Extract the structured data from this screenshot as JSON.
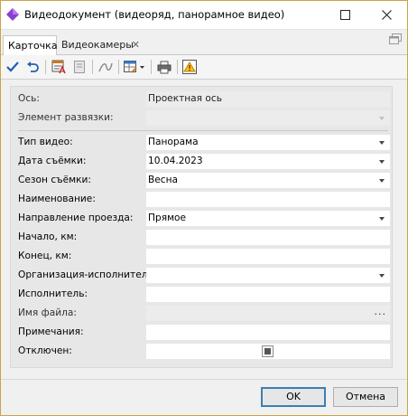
{
  "window": {
    "title": "Видеодокумент (видеоряд, панорамное видео)"
  },
  "tabs": [
    {
      "label": "Карточка",
      "active": true
    },
    {
      "label": "Видеокамеры",
      "active": false,
      "closable": true
    }
  ],
  "toolbar": {
    "items": [
      "check-icon",
      "undo-icon",
      "card-edit-icon",
      "document-icon",
      "curve-icon",
      "table-settings-icon",
      "printer-icon",
      "warning-icon"
    ]
  },
  "form": {
    "axis": {
      "label": "Ось:",
      "value": "Проектная ось"
    },
    "binding_element": {
      "label": "Элемент развязки:",
      "value": ""
    },
    "video_type": {
      "label": "Тип видео:",
      "value": "Панорама"
    },
    "shoot_date": {
      "label": "Дата съёмки:",
      "value": "10.04.2023"
    },
    "shoot_season": {
      "label": "Сезон съёмки:",
      "value": "Весна"
    },
    "name": {
      "label": "Наименование:",
      "value": ""
    },
    "direction": {
      "label": "Направление проезда:",
      "value": "Прямое"
    },
    "start_km": {
      "label": "Начало, км:",
      "value": ""
    },
    "end_km": {
      "label": "Конец, км:",
      "value": ""
    },
    "org": {
      "label": "Организация-исполнитель:",
      "value": ""
    },
    "executor": {
      "label": "Исполнитель:",
      "value": ""
    },
    "file_name": {
      "label": "Имя файла:",
      "value": "",
      "button": "..."
    },
    "notes": {
      "label": "Примечания:",
      "value": ""
    },
    "disabled": {
      "label": "Отключен:",
      "checked": "indeterminate"
    }
  },
  "buttons": {
    "ok": "OK",
    "cancel": "Отмена"
  },
  "colors": {
    "accent_border": "#3c7fb1",
    "window_border": "#c9a54a",
    "app_icon": "#8a3fd1"
  }
}
